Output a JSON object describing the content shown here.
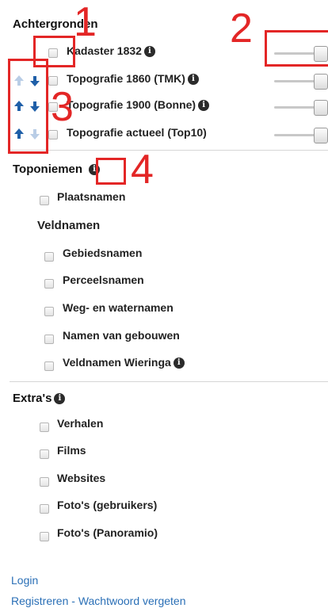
{
  "backgrounds": {
    "title": "Achtergronden",
    "layers": [
      {
        "label": "Kadaster 1832",
        "info": true,
        "checked": false
      },
      {
        "label": "Topografie 1860 (TMK)",
        "info": true,
        "checked": false
      },
      {
        "label": "Topografie 1900 (Bonne)",
        "info": true,
        "checked": false
      },
      {
        "label": "Topografie actueel (Top10)",
        "info": false,
        "checked": false
      }
    ]
  },
  "toponiemen": {
    "title": "Toponiemen",
    "items": [
      {
        "label": "Plaatsnamen",
        "checked": false
      }
    ],
    "veldnamen": {
      "title": "Veldnamen",
      "items": [
        {
          "label": "Gebiedsnamen",
          "checked": false
        },
        {
          "label": "Perceelsnamen",
          "checked": false
        },
        {
          "label": "Weg- en waternamen",
          "checked": false
        },
        {
          "label": "Namen van gebouwen",
          "checked": false
        },
        {
          "label": "Veldnamen Wieringa",
          "checked": false,
          "info": true
        }
      ]
    }
  },
  "extras": {
    "title": "Extra's",
    "items": [
      {
        "label": "Verhalen",
        "checked": false
      },
      {
        "label": "Films",
        "checked": false
      },
      {
        "label": "Websites",
        "checked": false
      },
      {
        "label": "Foto's (gebruikers)",
        "checked": false
      },
      {
        "label": "Foto's (Panoramio)",
        "checked": false
      }
    ]
  },
  "footer": {
    "login": "Login",
    "register": "Registreren",
    "separator": "-",
    "forgot_password": "Wachtwoord vergeten"
  },
  "callouts": [
    "1",
    "2",
    "3",
    "4"
  ],
  "info_glyph": "i",
  "colors": {
    "annotation": "#e32626",
    "link": "#2a6fb6",
    "arrow_active": "#1f5fa8",
    "arrow_disabled": "#b9cde6"
  }
}
